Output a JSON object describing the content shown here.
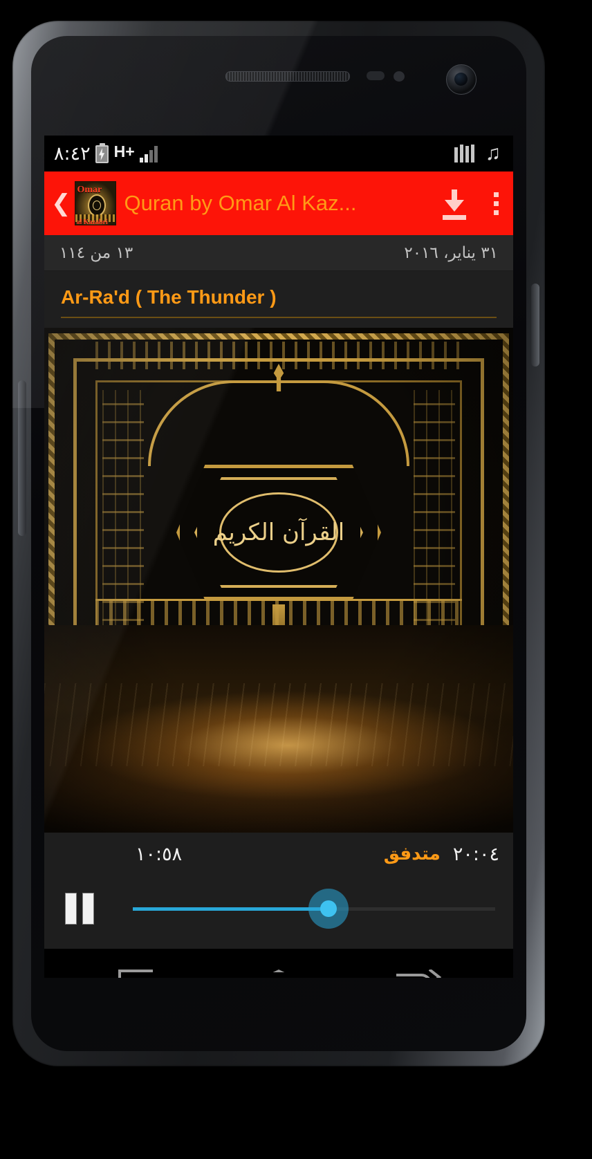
{
  "status_bar": {
    "time": "٨:٤٢",
    "battery_icon": "battery-charging-icon",
    "network_type": "H+",
    "signal_icon": "signal-bars-icon",
    "equalizer_icon": "equalizer-icon",
    "music_icon": "♫"
  },
  "app_bar": {
    "back_label": "❮",
    "app_icon_title": "Omar",
    "app_icon_subtitle": "al Kazabri",
    "title": "Quran by Omar Al Kaz...",
    "download_icon": "download-icon",
    "overflow_icon": "overflow-menu-icon",
    "background_color": "#fd1408",
    "title_color": "#ff9a16"
  },
  "meta_row": {
    "track_counter": "١٣ من ١١٤",
    "date": "٣١ يناير، ٢٠١٦"
  },
  "content": {
    "surah_title": "Ar-Ra'd ( The Thunder )",
    "surah_title_color": "#ff9a16",
    "artwork_name": "quran-cover-artwork",
    "artwork_medallion_text": "القرآن الكريم"
  },
  "player": {
    "current_time": "١٠:٥٨",
    "stream_label": "متدفق",
    "total_time": "٢٠:٠٤",
    "stream_label_color": "#ff9a16",
    "pause_icon": "pause-icon",
    "progress_percent": 54,
    "seek_accent_color": "#29a8d8"
  },
  "nav_bar": {
    "recents_icon": "recents-icon",
    "home_icon": "home-icon",
    "back_icon": "back-icon"
  }
}
